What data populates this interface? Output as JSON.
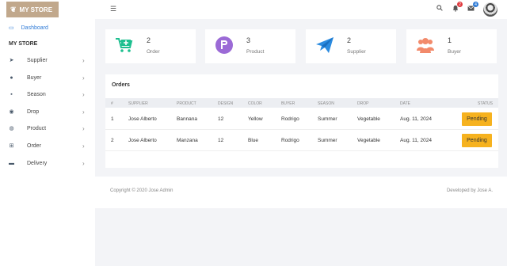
{
  "brand": {
    "name": "MY STORE"
  },
  "topbar": {
    "notif_count": "2",
    "mail_count": "4"
  },
  "sidebar": {
    "dashboard_label": "Dashboard",
    "section_label": "MY STORE",
    "items": [
      {
        "label": "Supplier",
        "icon": "paper-plane-icon"
      },
      {
        "label": "Buyer",
        "icon": "users-icon"
      },
      {
        "label": "Season",
        "icon": "calendar-icon"
      },
      {
        "label": "Drop",
        "icon": "drop-icon"
      },
      {
        "label": "Product",
        "icon": "product-icon"
      },
      {
        "label": "Order",
        "icon": "cart-icon"
      },
      {
        "label": "Delivery",
        "icon": "truck-icon"
      }
    ]
  },
  "cards": [
    {
      "value": "2",
      "label": "Order"
    },
    {
      "value": "3",
      "label": "Product"
    },
    {
      "value": "2",
      "label": "Supplier"
    },
    {
      "value": "1",
      "label": "Buyer"
    }
  ],
  "orders": {
    "title": "Orders",
    "columns": [
      "#",
      "SUPPLIER",
      "PRODUCT",
      "DESIGN",
      "COLOR",
      "BUYER",
      "SEASON",
      "DROP",
      "DATE",
      "STATUS"
    ],
    "rows": [
      {
        "num": "1",
        "supplier": "Jose Alberto",
        "product": "Bannana",
        "design": "12",
        "color": "Yellow",
        "buyer": "Rodrigo",
        "season": "Summer",
        "drop": "Vegetable",
        "date": "Aug. 11, 2024",
        "status": "Pending"
      },
      {
        "num": "2",
        "supplier": "Jose Alberto",
        "product": "Manzana",
        "design": "12",
        "color": "Blue",
        "buyer": "Rodrigo",
        "season": "Summer",
        "drop": "Vegetable",
        "date": "Aug. 11, 2024",
        "status": "Pending"
      }
    ]
  },
  "footer": {
    "copyright": "Copyright © 2020 Jose Admin",
    "developer": "Developed by Jose A."
  },
  "colors": {
    "brand": "#c1a88c",
    "accent": "#2f7bd6",
    "pending": "#f6b21f",
    "order_icon": "#1dbf8f",
    "product_icon": "#9b6ad6",
    "supplier_icon": "#2b8be0",
    "buyer_icon": "#f28a6b"
  }
}
